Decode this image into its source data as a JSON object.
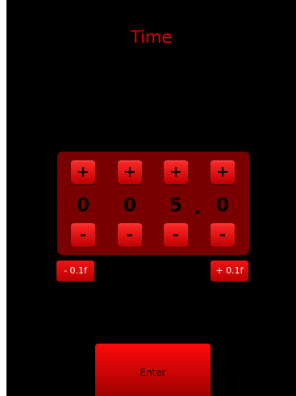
{
  "screen": {
    "title": "Time"
  },
  "value": {
    "digits": [
      "0",
      "0",
      "5",
      "0"
    ],
    "separator": ".",
    "display": "05.0"
  },
  "controls": {
    "increment_label": "+",
    "decrement_label": "-",
    "minus_small_label": "- 0.1f",
    "plus_small_label": "+ 0.1f",
    "enter_label": "Enter"
  },
  "colors": {
    "background": "#000000",
    "accent": "#e00000",
    "panel": "#7a0000"
  }
}
